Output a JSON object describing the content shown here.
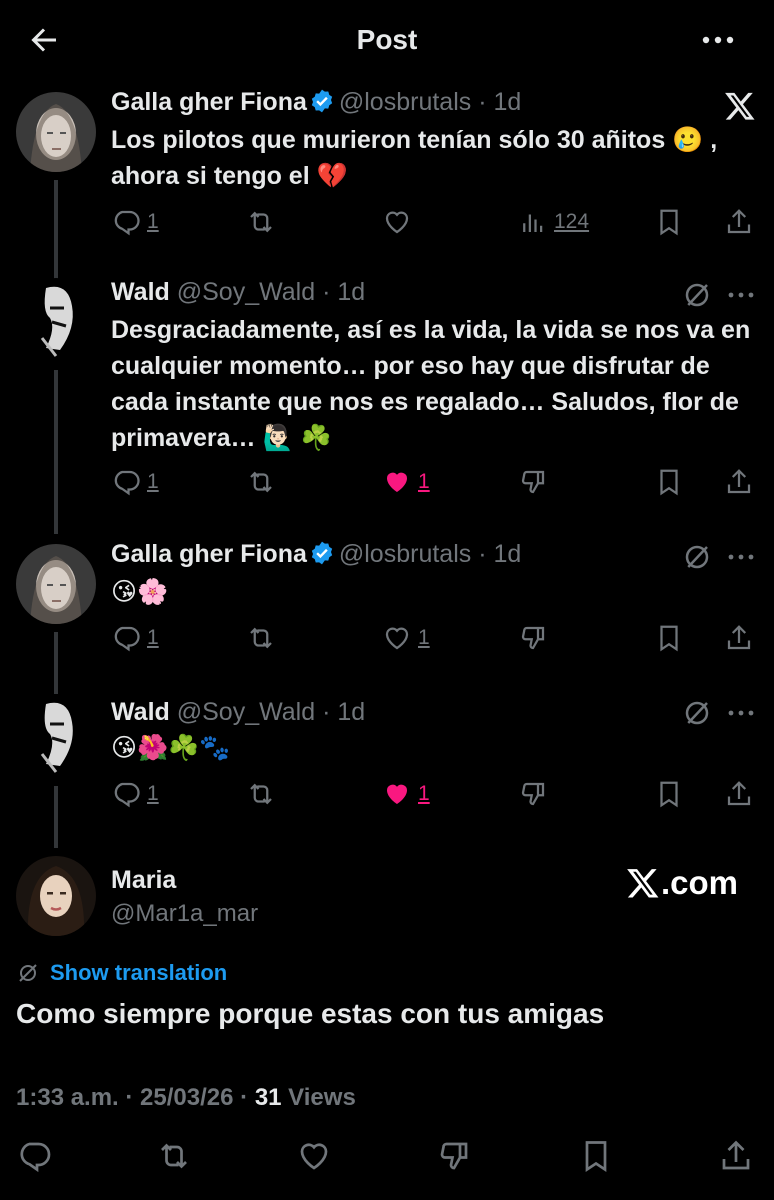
{
  "topbar": {
    "title": "Post",
    "back_icon": "arrow-left-icon",
    "more_icon": "more-icon"
  },
  "tweets": [
    {
      "name": "Galla gher Fiona",
      "handle": "@losbrutals",
      "dot": "·",
      "time": "1d",
      "verified": true,
      "text": "Los pilotos que murieron tenían sólo 30 añitos 🥲 , ahora si tengo el 💔",
      "corner_icon": "x-logo-icon",
      "actions": {
        "reply": "1",
        "repost": "",
        "like": "",
        "views": "124"
      }
    },
    {
      "name": "Wald",
      "handle": "@Soy_Wald",
      "dot": "·",
      "time": "1d",
      "verified": false,
      "text": "Desgraciadamente, así es la vida, la vida se nos va en cualquier momento… por eso hay que disfrutar de cada instante que nos es regalado… Saludos, flor de primavera… 🙋🏻‍♂️ ☘️",
      "corner_icon": "grok-icon",
      "actions": {
        "reply": "1",
        "repost": "",
        "like": "1",
        "liked": true
      }
    },
    {
      "name": "Galla gher Fiona",
      "handle": "@losbrutals",
      "dot": "·",
      "time": "1d",
      "verified": true,
      "text": "😘🌸",
      "corner_icon": "grok-icon",
      "actions": {
        "reply": "1",
        "repost": "",
        "like": "1",
        "liked": false
      }
    },
    {
      "name": "Wald",
      "handle": "@Soy_Wald",
      "dot": "·",
      "time": "1d",
      "verified": false,
      "text": "😘🌺☘️🐾",
      "corner_icon": "grok-icon",
      "actions": {
        "reply": "1",
        "repost": "",
        "like": "1",
        "liked": true
      }
    }
  ],
  "main": {
    "name": "Maria",
    "handle": "@Mar1a_mar",
    "brand": ".com",
    "translate_label": "Show translation",
    "text": "Como siempre porque estas con tus amigas",
    "timestamp": "1:33 a.m. · 25/03/26 · ",
    "views_count": "31",
    "views_label": " Views"
  },
  "colors": {
    "accent": "#1d9bf0",
    "like": "#f91880",
    "muted": "#71767b",
    "text": "#e7e9ea",
    "bg": "#000000"
  }
}
